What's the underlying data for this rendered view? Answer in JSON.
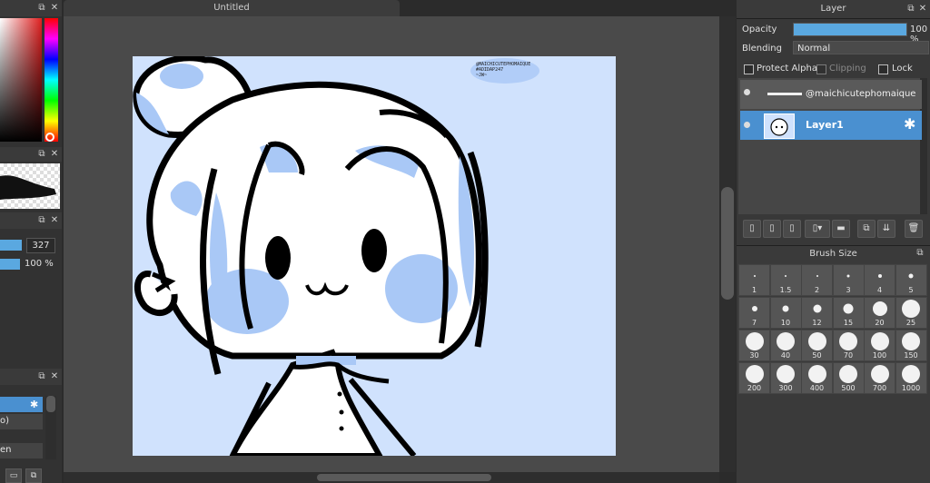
{
  "document": {
    "tab_title": "Untitled"
  },
  "left_panels": {
    "slider_a_value": "327",
    "slider_b_value": "100 %",
    "layer_stub_1": "o)",
    "layer_stub_2": "en"
  },
  "artwork": {
    "watermark_lines": [
      "@MAICHICUTEPHOMAIQUE",
      "#ADIDAP247",
      "~JW~"
    ]
  },
  "layer_panel": {
    "title": "Layer",
    "opacity_label": "Opacity",
    "opacity_value": "100 %",
    "opacity_fraction": 1.0,
    "blending_label": "Blending",
    "blending_value": "Normal",
    "protect_alpha_label": "Protect Alpha",
    "clipping_label": "Clipping",
    "lock_label": "Lock",
    "layers": [
      {
        "name": "@maichicutephomaique",
        "selected": false
      },
      {
        "name": "Layer1",
        "selected": true
      }
    ],
    "accent_color": "#4a90d0"
  },
  "brush_panel": {
    "title": "Brush Size",
    "sizes": [
      "1",
      "1.5",
      "2",
      "3",
      "4",
      "5",
      "7",
      "10",
      "12",
      "15",
      "20",
      "25",
      "30",
      "40",
      "50",
      "70",
      "100",
      "150",
      "200",
      "300",
      "400",
      "500",
      "700",
      "1000"
    ]
  }
}
